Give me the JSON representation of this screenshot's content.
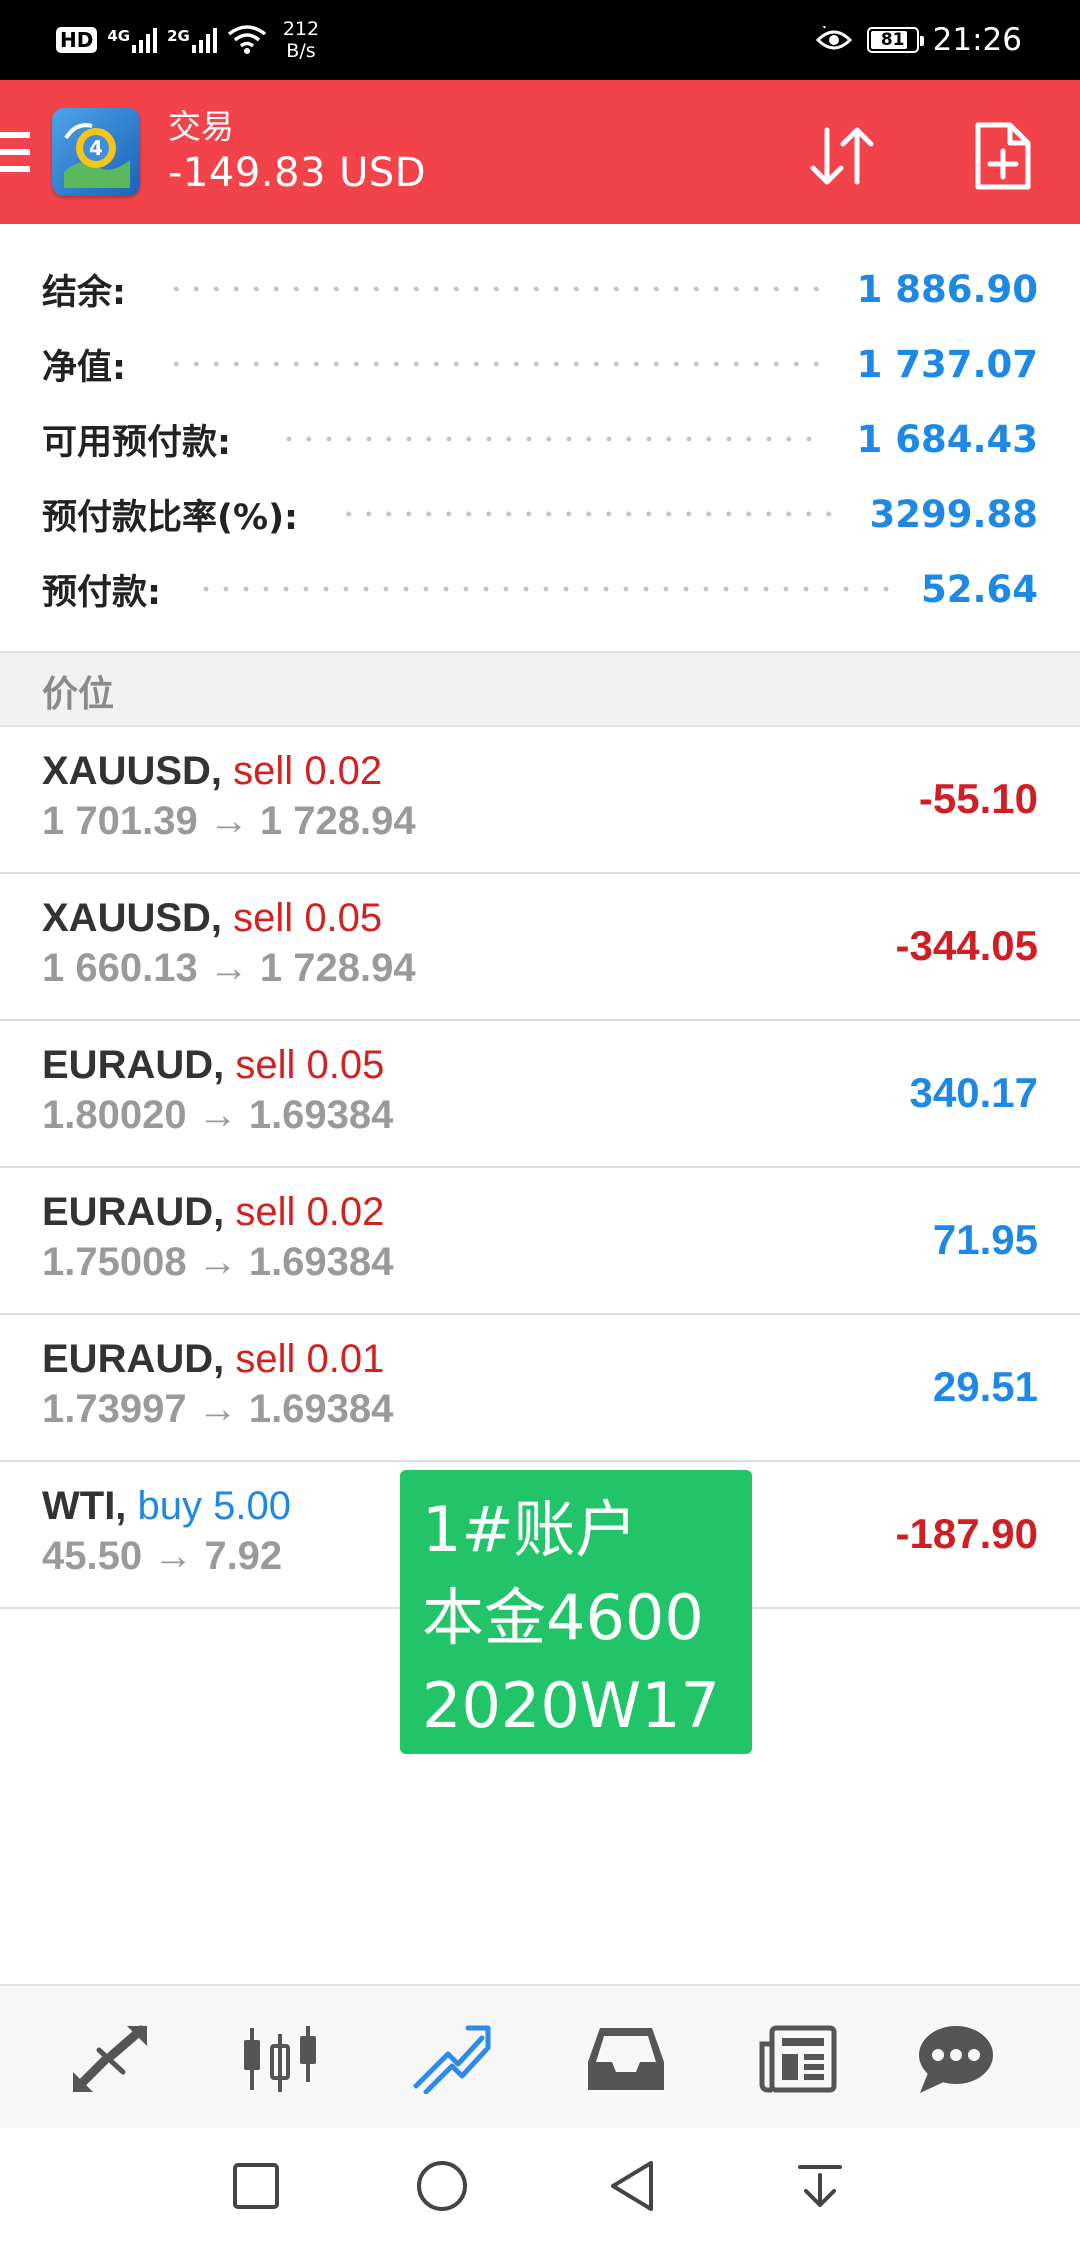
{
  "status_bar": {
    "hd": "HD",
    "sim1_network": "4G",
    "sim2_network": "2G",
    "net_speed_value": "212",
    "net_speed_unit": "B/s",
    "battery": "81",
    "time": "21:26"
  },
  "header": {
    "title": "交易",
    "subtitle": "-149.83 USD",
    "sort_icon": "sort-arrows-icon",
    "new_order_icon": "new-order-icon"
  },
  "summary": [
    {
      "label": "结余:",
      "value": "1 886.90"
    },
    {
      "label": "净值:",
      "value": "1 737.07"
    },
    {
      "label": "可用预付款:",
      "value": "1 684.43"
    },
    {
      "label": "预付款比率(%):",
      "value": "3299.88"
    },
    {
      "label": "预付款:",
      "value": "52.64"
    }
  ],
  "section": {
    "title": "价位"
  },
  "positions": [
    {
      "symbol": "XAUUSD,",
      "side": "sell",
      "volume": "0.02",
      "prices": "1 701.39 → 1 728.94",
      "profit": "-55.10"
    },
    {
      "symbol": "XAUUSD,",
      "side": "sell",
      "volume": "0.05",
      "prices": "1 660.13 → 1 728.94",
      "profit": "-344.05"
    },
    {
      "symbol": "EURAUD,",
      "side": "sell",
      "volume": "0.05",
      "prices": "1.80020 → 1.69384",
      "profit": "340.17"
    },
    {
      "symbol": "EURAUD,",
      "side": "sell",
      "volume": "0.02",
      "prices": "1.75008 → 1.69384",
      "profit": "71.95"
    },
    {
      "symbol": "EURAUD,",
      "side": "sell",
      "volume": "0.01",
      "prices": "1.73997 → 1.69384",
      "profit": "29.51"
    },
    {
      "symbol": "WTI,",
      "side": "buy",
      "volume": "5.00",
      "prices": "45.50 → 7.92",
      "profit": "-187.90"
    }
  ],
  "sticker": {
    "line1": "1#账户",
    "line2": "本金4600",
    "line3": "2020W17"
  },
  "bottom_nav": {
    "items": [
      "quotes-icon",
      "chart-icon",
      "trade-icon",
      "history-icon",
      "news-icon",
      "chat-icon"
    ],
    "active": "trade-icon"
  },
  "system_nav": [
    "recents-square-icon",
    "home-circle-icon",
    "back-triangle-icon",
    "notification-pulldown-icon"
  ],
  "colors": {
    "header_bg": "#f2434a",
    "accent_blue": "#1e88e5",
    "loss_red": "#cf1f24",
    "sticker_green": "#22c46a"
  }
}
